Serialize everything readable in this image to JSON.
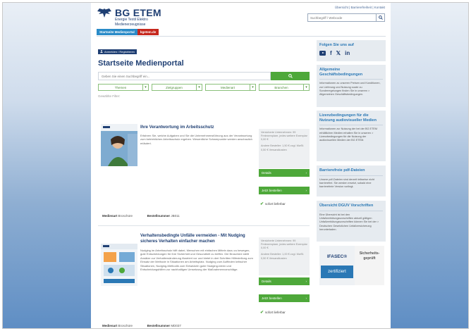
{
  "header": {
    "brand": "BG ETEM",
    "brand_sub_1": "Energie Textil Elektro",
    "brand_sub_2": "Medienerzeugnisse",
    "top_links": "Übersicht | Barrierefreiheit | Kontakt",
    "search_placeholder": "Suchbegriff / Webcode"
  },
  "nav": {
    "tab_1": "Startseite Medienportal",
    "tab_2": "bgetem.de"
  },
  "main": {
    "login_label": "Anmelden / Registrieren",
    "title": "Startseite Medienportal",
    "search_placeholder": "Geben Sie einen Suchbegriff ein...",
    "filters": [
      "Themen",
      "Zielgruppen",
      "Medienart",
      "Branchen"
    ],
    "reset_label": "Gewählte Filter:",
    "count_label": "Gefundene Artikel: 738"
  },
  "products": [
    {
      "title": "Ihre Verantwortung im Arbeitsschutz",
      "description": "Erfahren Sie, welche Aufgaben und Sie die Unternehmensführung aus der Verantwortung zum betrieblichen Arbeitsschutz ergeben. Wesentliche Schwerpunkte werden anschaulich erläutert.",
      "side_text_1": "Versicherte Unternehmen: 99 Freiexemplare, jedes weitere Exemplar 0,00 €",
      "side_text_2": "Andere Besteller: 1,50 € zzgl. MwSt. 0,50 € Versandkosten",
      "details_label": "Details",
      "order_label": "Jetzt bestellen",
      "availability": "sofort lieferbar",
      "media_type_label": "Medienart",
      "media_type": "Broschüre",
      "order_no_label": "Bestellnummer",
      "order_no": "JB011"
    },
    {
      "title": "Verhaltensbedingte Unfälle vermeiden - Mit Nudging sicheres Verhalten einfacher machen",
      "description": "Nudging im Arbeitsschutz hilft dabei, Menschen mit einfachen Mitteln dazu zu bewegen, gute Entscheidungen für ihre Sicherheit und Gesundheit zu treffen. Die Broschüre stellt Ansätze zur Verhaltensänderung illustriert vor und bietet in drei Schritten Hilfestellung zum Einsatz der Methode in Situationen am Arbeitsplatz. Nudging zum Auffinden kritischer Situationen, Nudging-Methodik zum Entwickeln guter Nudging-Ideen und Entscheidungshilfen zur nachhaltigen Umsetzung der Maßnahmenvorschläge.",
      "side_text_1": "Versicherte Unternehmen: 99 Freiexemplare, jedes weitere Exemplar 0,00 €",
      "side_text_2": "Andere Besteller: 1,00 € zzgl. MwSt. 0,50 € Versandkosten",
      "details_label": "Details",
      "order_label": "Jetzt bestellen",
      "availability": "sofort lieferbar",
      "media_type_label": "Medienart",
      "media_type": "Broschüre",
      "order_no_label": "Bestellnummer",
      "order_no": "MD037"
    }
  ],
  "sidebar": {
    "follow_title": "Folgen Sie uns auf",
    "boxes": [
      {
        "title": "Allgemeine Geschäftsbedingungen",
        "text": "Informationen zu unseren Preisen und Konditionen, zur Lieferung und Nutzung sowie zu Sonderregelungen finden Sie in unseren > Allgemeinen Geschäftsbedingungen."
      },
      {
        "title": "Lizenzbedingungen für die Nutzung audiovisueller Medien",
        "text": "Informationen zur Nutzung der bei der BG ETEM erhältlichen Medien erhalten Sie in unseren > Lizenzbedingungen für die Nutzung der audiovisuellen Medien der BG ETEM."
      },
      {
        "title": "Barrierefreie pdf-Dateien",
        "text": "Unsere pdf-Dateien sind derzeit teilweise nicht barrierefrei. Sie werden ersetzt, sobald eine barrierefreie Version vorliegt."
      },
      {
        "title": "Übersicht DGUV Vorschriften",
        "text": "Eine Übersicht ist bei den Unfallverhütungsvorschriften aktuell gültigen Unfallverhütungsvorschriften können Sie bei der > Deutschen Gesetzlichen Unfallversicherung herunterladen."
      }
    ],
    "seal_name": "IFASEC®",
    "seal_cert": "zertifiziert",
    "seal_right": "Sicherheits-geprüft"
  }
}
